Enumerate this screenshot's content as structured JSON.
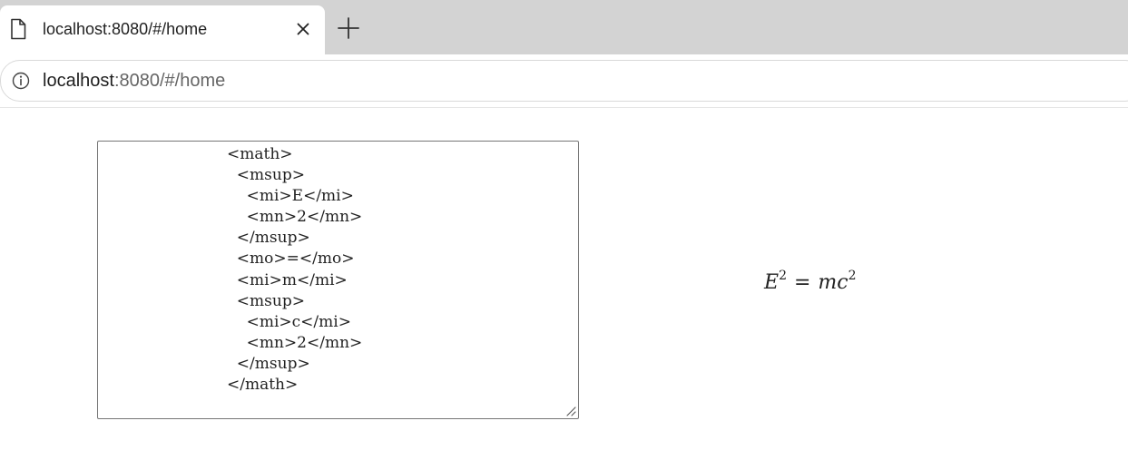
{
  "tab": {
    "title": "localhost:8080/#/home",
    "icon": "document-icon"
  },
  "address_bar": {
    "host": "localhost",
    "rest": ":8080/#/home"
  },
  "editor": {
    "code": "<math>\n  <msup>\n    <mi>E</mi>\n    <mn>2</mn>\n  </msup>\n  <mo>=</mo>\n  <mi>m</mi>\n  <msup>\n    <mi>c</mi>\n    <mn>2</mn>\n  </msup>\n</math>"
  },
  "rendered_formula": {
    "base1": "E",
    "exp1": "2",
    "operator": "=",
    "term1": "m",
    "base2": "c",
    "exp2": "2"
  }
}
